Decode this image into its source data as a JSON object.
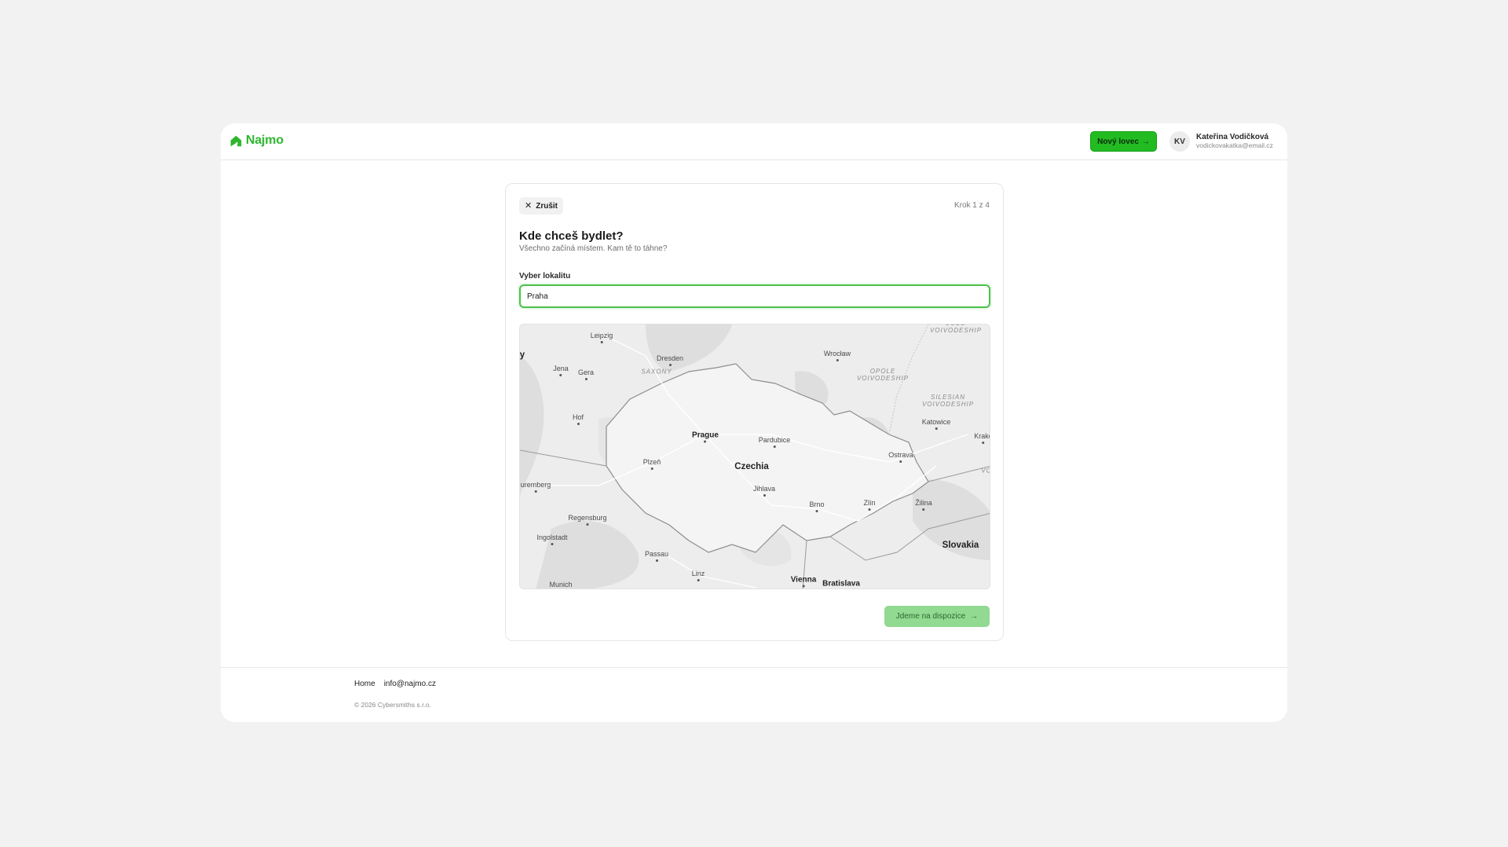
{
  "brand": {
    "name": "Najmo",
    "color": "#2fb52f"
  },
  "header": {
    "new_hunter_label": "Nový lovec",
    "new_hunter_icon": "arrow-right-icon",
    "user": {
      "initials": "KV",
      "name": "Kateřina Vodičková",
      "email": "vodickovakatka@email.cz"
    }
  },
  "wizard": {
    "cancel_label": "Zrušit",
    "step_label": "Krok 1 z 4",
    "title": "Kde chceš bydlet?",
    "subtitle": "Všechno začíná místem. Kam tě to táhne?",
    "field_label": "Vyber lokalitu",
    "location_value": "Praha",
    "continue_label": "Jdeme na dispozice",
    "continue_icon": "arrow-right-icon"
  },
  "map": {
    "labels": {
      "leipzig": "Leipzig",
      "dresden": "Dresden",
      "jena": "Jena",
      "gera": "Gera",
      "saxony": "SAXONY",
      "hof": "Hof",
      "prague": "Prague",
      "pardubice": "Pardubice",
      "plzen": "Plzeň",
      "czechia": "Czechia",
      "jihlava": "Jihlava",
      "brno": "Brno",
      "zlin": "Zlín",
      "zilina": "Žilina",
      "ostrava": "Ostrava",
      "katowice": "Katowice",
      "krakow": "Krako",
      "wroclaw": "Wrocław",
      "opole": "OPOLE\nVOIVODESHIP",
      "silesian": "SILESIAN\nVOIVODESHIP",
      "lodz": "ŁÓDŹ\nVOIVODESHIP",
      "nuremberg": "uremberg",
      "regensburg": "Regensburg",
      "ingolstadt": "Ingolstadt",
      "passau": "Passau",
      "linz": "Linz",
      "munich": "Munich",
      "vienna": "Vienna",
      "bratislava": "Bratislava",
      "slovakia": "Slovakia",
      "edge_y": "y",
      "edge_vo": "VO"
    }
  },
  "footer": {
    "home_link": "Home",
    "email_link": "info@najmo.cz",
    "copyright": "© 2026 Cybersmiths s.r.o."
  }
}
